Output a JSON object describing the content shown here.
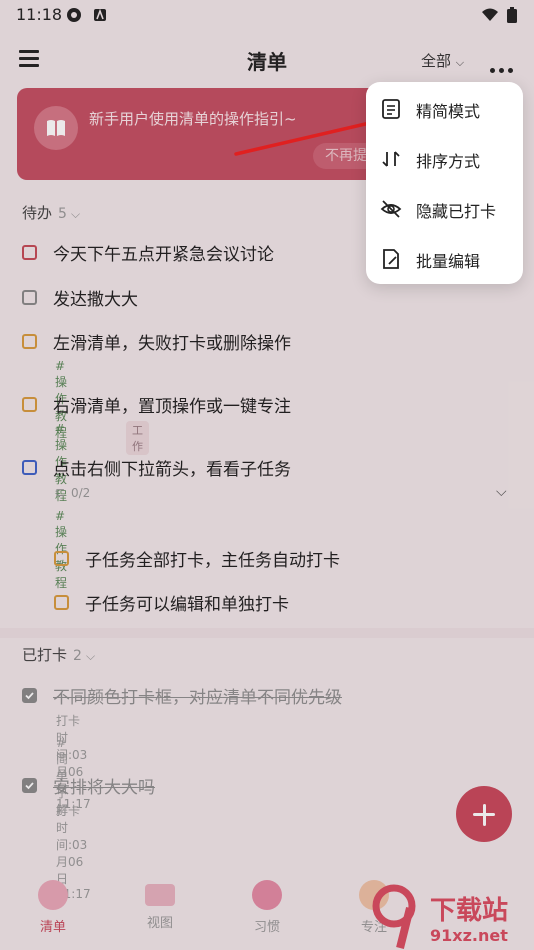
{
  "status": {
    "time": "11:18"
  },
  "header": {
    "title": "清单",
    "filter": "全部"
  },
  "banner": {
    "text": "新手用户使用清单的操作指引~",
    "button": "不再提"
  },
  "todo": {
    "title": "待办",
    "count": "5",
    "items": [
      {
        "text": "今天下午五点开紧急会议讨论",
        "color": "#c44a56"
      },
      {
        "text": "发达撒大大",
        "color": "#8a8a8a"
      },
      {
        "text": "左滑清单，失败打卡或删除操作",
        "color": "#d79a3d",
        "tag": "#操作教程"
      },
      {
        "text": "右滑清单，置顶操作或一键专注",
        "color": "#d79a3d",
        "tag": "#操作教程",
        "tag2": "工作"
      },
      {
        "text": "点击右侧下拉箭头，看看子任务",
        "color": "#3f63c9",
        "subcount": "0/2",
        "tag": "#操作教程"
      }
    ],
    "subtasks": [
      {
        "text": "子任务全部打卡，主任务自动打卡",
        "color": "#d79a3d"
      },
      {
        "text": "子任务可以编辑和单独打卡",
        "color": "#d79a3d"
      }
    ]
  },
  "done": {
    "title": "已打卡",
    "count": "2",
    "items": [
      {
        "text": "不同颜色打卡框，对应清单不同优先级",
        "meta": "打卡时间:03月06日 11:17",
        "tag": "#简单了解"
      },
      {
        "text": "安排将大大吗",
        "meta": "打卡时间:03月06日 11:17"
      }
    ]
  },
  "menu": {
    "items": [
      {
        "label": "精简模式",
        "icon": "list-doc-icon"
      },
      {
        "label": "排序方式",
        "icon": "sort-icon"
      },
      {
        "label": "隐藏已打卡",
        "icon": "eye-off-icon"
      },
      {
        "label": "批量编辑",
        "icon": "edit-doc-icon"
      }
    ]
  },
  "nav": {
    "items": [
      {
        "label": "清单",
        "active": true
      },
      {
        "label": "视图"
      },
      {
        "label": "习惯"
      },
      {
        "label": "专注"
      }
    ]
  },
  "watermark": {
    "text": "下载站",
    "url": "91xz.net"
  },
  "colors": {
    "accent": "#c9485b",
    "banner": "#c34e61"
  }
}
